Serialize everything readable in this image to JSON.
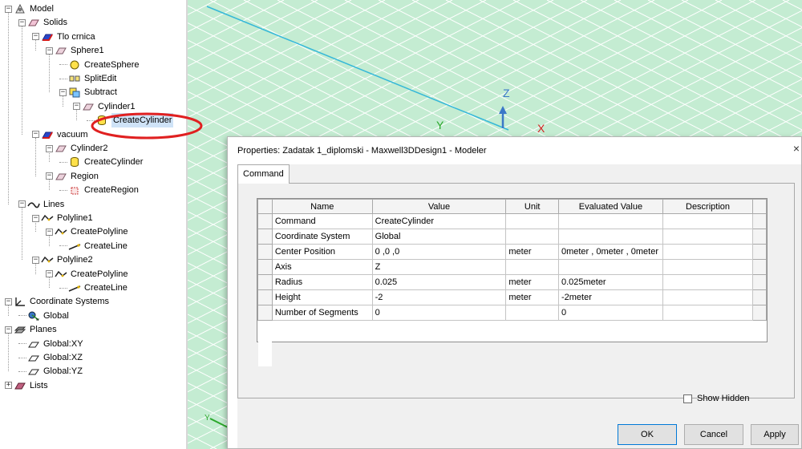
{
  "tree": [
    {
      "label": "Model",
      "icon": "model-icon",
      "depth": 0,
      "expander": "minus"
    },
    {
      "label": "Solids",
      "icon": "solid-folder-icon",
      "depth": 1,
      "expander": "minus"
    },
    {
      "label": "Tlo crnica",
      "icon": "material-icon",
      "depth": 2,
      "expander": "minus"
    },
    {
      "label": "Sphere1",
      "icon": "solid-object-icon",
      "depth": 3,
      "expander": "minus"
    },
    {
      "label": "CreateSphere",
      "icon": "sphere-icon",
      "depth": 4,
      "expander": "none"
    },
    {
      "label": "SplitEdit",
      "icon": "split-icon",
      "depth": 4,
      "expander": "none"
    },
    {
      "label": "Subtract",
      "icon": "subtract-icon",
      "depth": 4,
      "expander": "minus"
    },
    {
      "label": "Cylinder1",
      "icon": "solid-object-icon",
      "depth": 5,
      "expander": "minus"
    },
    {
      "label": "CreateCylinder",
      "icon": "cylinder-icon",
      "depth": 6,
      "expander": "none",
      "selected": true
    },
    {
      "label": "vacuum",
      "icon": "material-icon",
      "depth": 2,
      "expander": "minus"
    },
    {
      "label": "Cylinder2",
      "icon": "solid-object-icon",
      "depth": 3,
      "expander": "minus"
    },
    {
      "label": "CreateCylinder",
      "icon": "cylinder-icon",
      "depth": 4,
      "expander": "none"
    },
    {
      "label": "Region",
      "icon": "solid-object-icon",
      "depth": 3,
      "expander": "minus"
    },
    {
      "label": "CreateRegion",
      "icon": "region-icon",
      "depth": 4,
      "expander": "none"
    },
    {
      "label": "Lines",
      "icon": "lines-icon",
      "depth": 1,
      "expander": "minus"
    },
    {
      "label": "Polyline1",
      "icon": "polyline-icon",
      "depth": 2,
      "expander": "minus"
    },
    {
      "label": "CreatePolyline",
      "icon": "polyline-icon",
      "depth": 3,
      "expander": "minus"
    },
    {
      "label": "CreateLine",
      "icon": "line-icon",
      "depth": 4,
      "expander": "none"
    },
    {
      "label": "Polyline2",
      "icon": "polyline-icon",
      "depth": 2,
      "expander": "minus"
    },
    {
      "label": "CreatePolyline",
      "icon": "polyline-icon",
      "depth": 3,
      "expander": "minus"
    },
    {
      "label": "CreateLine",
      "icon": "line-icon",
      "depth": 4,
      "expander": "none"
    },
    {
      "label": "Coordinate Systems",
      "icon": "coordinate-system-icon",
      "depth": 0,
      "expander": "minus"
    },
    {
      "label": "Global",
      "icon": "global-cs-icon",
      "depth": 1,
      "expander": "none"
    },
    {
      "label": "Planes",
      "icon": "planes-icon",
      "depth": 0,
      "expander": "minus"
    },
    {
      "label": "Global:XY",
      "icon": "plane-icon",
      "depth": 1,
      "expander": "none"
    },
    {
      "label": "Global:XZ",
      "icon": "plane-icon",
      "depth": 1,
      "expander": "none"
    },
    {
      "label": "Global:YZ",
      "icon": "plane-icon",
      "depth": 1,
      "expander": "none"
    },
    {
      "label": "Lists",
      "icon": "lists-icon",
      "depth": 0,
      "expander": "plus"
    }
  ],
  "viewport": {
    "axis_labels": {
      "z": "Z",
      "y": "Y",
      "x": "X",
      "triad_y": "Y"
    },
    "colors": {
      "background": "#c4ecd2",
      "grid": "#ffffff",
      "z_axis": "#3b78c8",
      "y_axis": "#2aa82a",
      "x_axis": "#d42020",
      "cyan_line": "#35b8d8"
    }
  },
  "dialog": {
    "title": "Properties: Zadatak 1_diplomski - Maxwell3DDesign1 - Modeler",
    "close_glyph": "×",
    "tab": "Command",
    "columns": [
      "Name",
      "Value",
      "Unit",
      "Evaluated Value",
      "Description"
    ],
    "rows": [
      {
        "name": "Command",
        "value": "CreateCylinder",
        "unit": "",
        "evaluated": "",
        "description": ""
      },
      {
        "name": "Coordinate System",
        "value": "Global",
        "unit": "",
        "evaluated": "",
        "description": ""
      },
      {
        "name": "Center Position",
        "value": "0 ,0 ,0",
        "unit": "meter",
        "evaluated": "0meter , 0meter , 0meter",
        "description": ""
      },
      {
        "name": "Axis",
        "value": "Z",
        "unit": "",
        "evaluated": "",
        "description": ""
      },
      {
        "name": "Radius",
        "value": "0.025",
        "unit": "meter",
        "evaluated": "0.025meter",
        "description": ""
      },
      {
        "name": "Height",
        "value": "-2",
        "unit": "meter",
        "evaluated": "-2meter",
        "description": ""
      },
      {
        "name": "Number of Segments",
        "value": "0",
        "unit": "",
        "evaluated": "0",
        "description": ""
      }
    ],
    "show_hidden_label": "Show Hidden",
    "show_hidden_checked": false,
    "buttons": {
      "ok": "OK",
      "cancel": "Cancel",
      "apply": "Apply"
    }
  },
  "annotation": {
    "color": "#e02020",
    "target": "CreateCylinder"
  }
}
